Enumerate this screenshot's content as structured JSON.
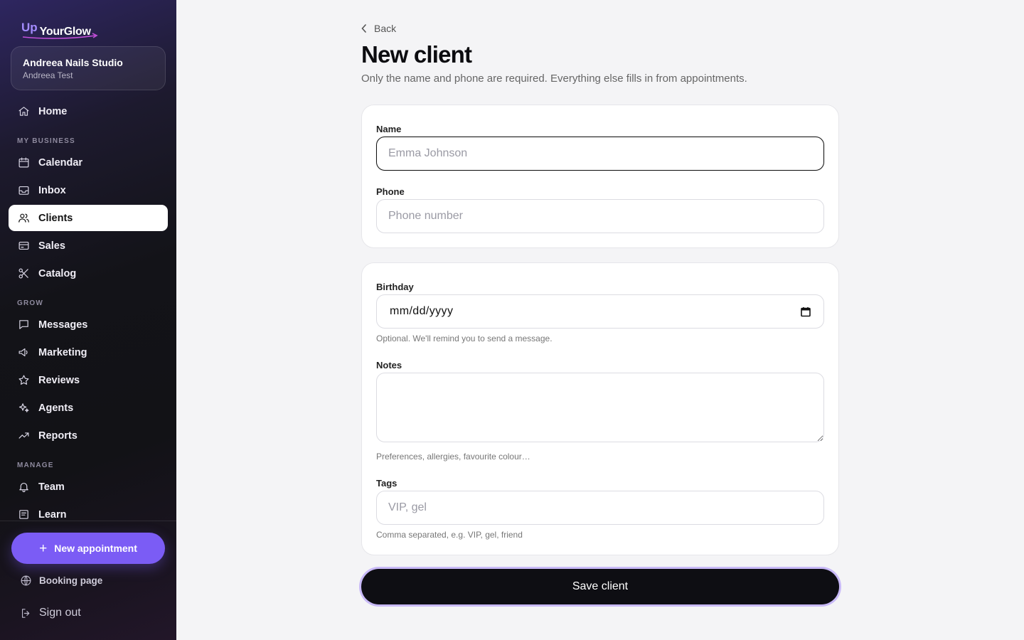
{
  "brand": {
    "logo_up": "Up",
    "logo_name": "YourGlow"
  },
  "studio": {
    "name": "Andreea Nails Studio",
    "user": "Andreea Test"
  },
  "nav": {
    "home": "Home",
    "section_business": "MY BUSINESS",
    "calendar": "Calendar",
    "inbox": "Inbox",
    "clients": "Clients",
    "sales": "Sales",
    "catalog": "Catalog",
    "section_grow": "GROW",
    "messages": "Messages",
    "marketing": "Marketing",
    "reviews": "Reviews",
    "agents": "Agents",
    "reports": "Reports",
    "section_manage": "MANAGE",
    "team": "Team",
    "learn": "Learn"
  },
  "actions": {
    "new_appointment": "New appointment",
    "booking_page": "Booking page",
    "sign_out": "Sign out"
  },
  "page": {
    "back": "Back",
    "title": "New client",
    "subtitle": "Only the name and phone are required. Everything else fills in from appointments."
  },
  "form": {
    "name_label": "Name",
    "name_placeholder": "Emma Johnson",
    "phone_label": "Phone",
    "phone_placeholder": "Phone number",
    "birthday_label": "Birthday",
    "birthday_value": "mm/dd/yyyy",
    "birthday_hint": "Optional. We'll remind you to send a message.",
    "notes_label": "Notes",
    "notes_hint": "Preferences, allergies, favourite colour…",
    "tags_label": "Tags",
    "tags_placeholder": "VIP, gel",
    "tags_hint": "Comma separated, e.g. VIP, gel, friend",
    "save_label": "Save client"
  },
  "colors": {
    "accent": "#7b5cf5",
    "active_nav_bg": "#ffffff",
    "save_bg": "#0e0e13"
  }
}
